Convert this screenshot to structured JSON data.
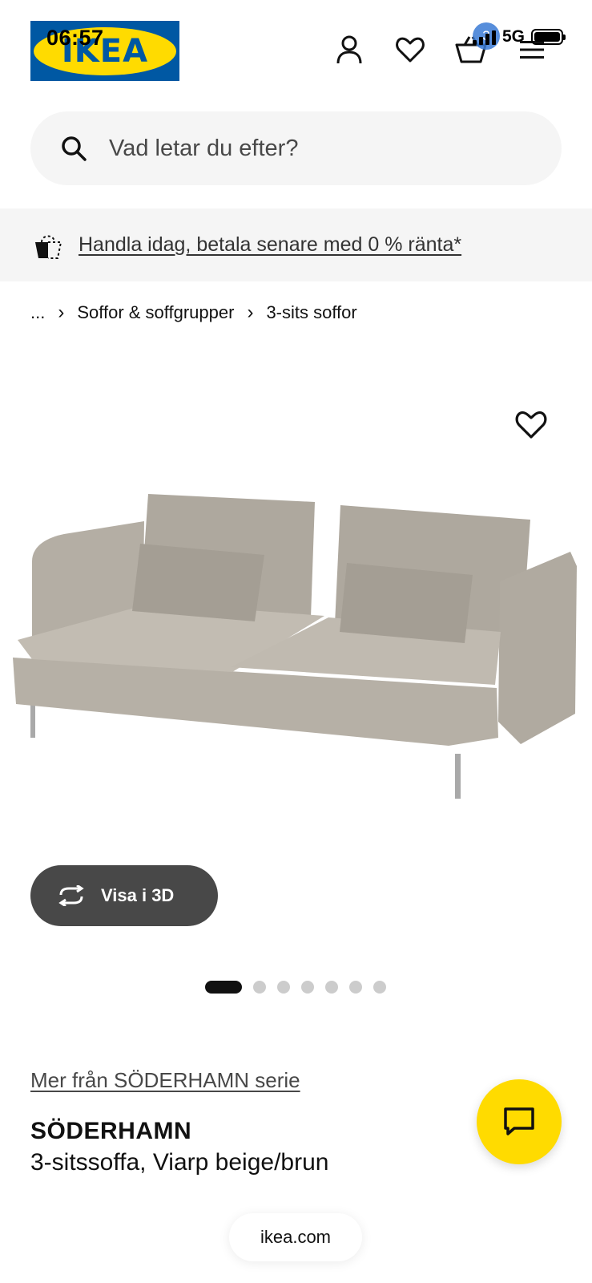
{
  "status_bar": {
    "time": "06:57",
    "network": "5G"
  },
  "header": {
    "logo_text": "IKEA",
    "cart_count": "3",
    "icons": [
      "user-icon",
      "heart-icon",
      "cart-icon",
      "menu-icon"
    ]
  },
  "search": {
    "placeholder": "Vad letar du efter?"
  },
  "promo": {
    "text": "Handla idag, betala senare med 0 % ränta*"
  },
  "breadcrumb": {
    "ellipsis": "...",
    "items": [
      "Soffor & soffgrupper",
      "3-sits soffor"
    ]
  },
  "gallery": {
    "view3d_label": "Visa i 3D",
    "total_images": 7,
    "active_index": 0
  },
  "product": {
    "series_link": "Mer från SÖDERHAMN serie",
    "name": "SÖDERHAMN",
    "description": "3-sitssoffa, Viarp beige/brun"
  },
  "browser": {
    "url": "ikea.com"
  },
  "colors": {
    "ikea_blue": "#0058a3",
    "ikea_yellow": "#ffdb00",
    "dark_button": "#484848"
  }
}
